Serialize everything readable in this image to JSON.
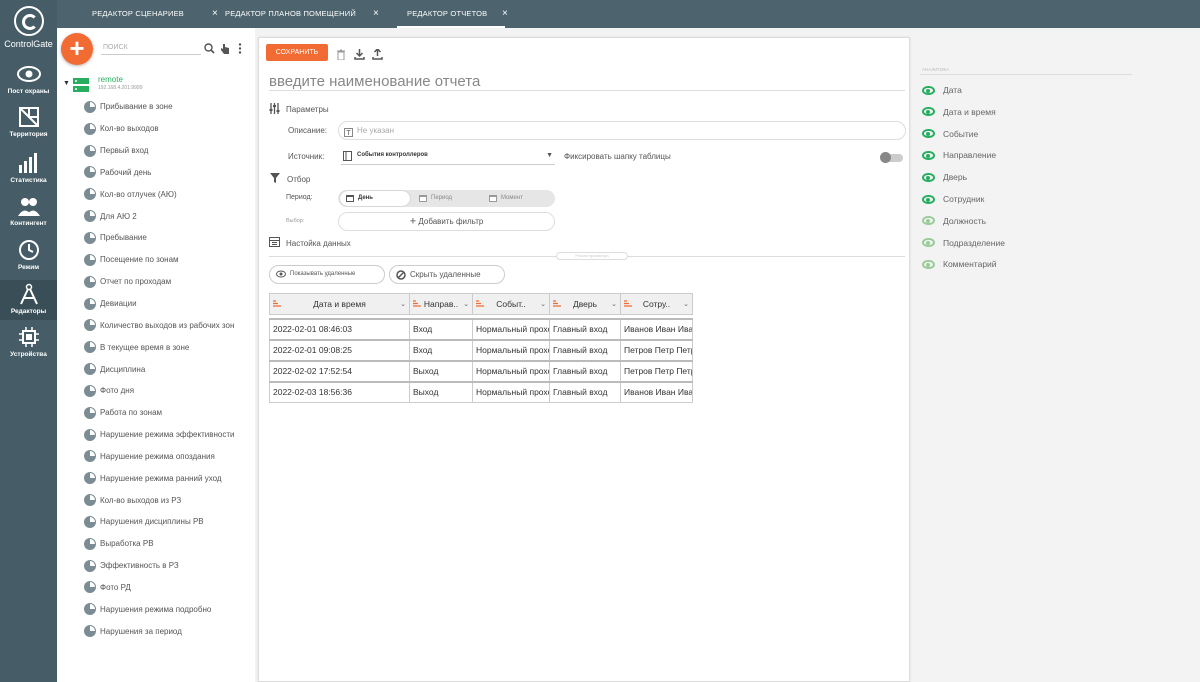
{
  "app": {
    "logo_text": "ControlGate"
  },
  "rail": [
    {
      "label": "Пост охраны",
      "icon": "eye-icon"
    },
    {
      "label": "Территория",
      "icon": "map-icon"
    },
    {
      "label": "Статистика",
      "icon": "bar-chart-icon"
    },
    {
      "label": "Контингент",
      "icon": "people-icon"
    },
    {
      "label": "Режим",
      "icon": "clock-icon"
    },
    {
      "label": "Редакторы",
      "icon": "compass-icon"
    },
    {
      "label": "Устройства",
      "icon": "chip-icon"
    }
  ],
  "tabs": [
    {
      "label": "РЕДАКТОР СЦЕНАРИЕВ",
      "close": "×"
    },
    {
      "label": "РЕДАКТОР ПЛАНОВ ПОМЕЩЕНИЙ",
      "close": "×"
    },
    {
      "label": "РЕДАКТОР ОТЧЕТОВ",
      "close": "×"
    }
  ],
  "sidebar": {
    "add_label": "+",
    "search_placeholder": "ПОИСК",
    "root": {
      "name": "remote",
      "ip": "192.168.4.201:9999"
    },
    "items": [
      "Прибывание в зоне",
      "Кол-во выходов",
      "Первый вход",
      "Рабочий день",
      "Кол-во отлучек (АЮ)",
      "Для АЮ 2",
      "Пребывание",
      "Посещение по зонам",
      "Отчет по проходам",
      "Девиации",
      "Количество выходов из рабочих зон",
      "В текущее время в зоне",
      "Дисциплина",
      "Фото дня",
      "Работа по зонам",
      "Нарушение режима эффективности",
      "Нарушение режима опоздания",
      "Нарушение режима ранний уход",
      "Кол-во выходов из РЗ",
      "Нарушения дисциплины РВ",
      "Выработка РВ",
      "Эффективность в РЗ",
      "Фото РД",
      "Нарушения режима подробно",
      "Нарушения за период"
    ]
  },
  "editor": {
    "save_label": "СОХРАНИТЬ",
    "title_placeholder": "введите наименование отчета",
    "params_label": "Параметры",
    "desc_label": "Описание:",
    "desc_placeholder": "Не указан",
    "source_label": "Источник:",
    "source_value": "События контроллеров",
    "fix_header_label": "Фиксировать шапку таблицы",
    "filter_label": "Отбор",
    "period_label": "Период:",
    "period_options": [
      "День",
      "Период",
      "Момент"
    ],
    "selection_label": "Выбор:",
    "add_filter_label": "Добавить фильтр",
    "data_settings_label": "Настойка данных",
    "divider_label": "Режим просмотра",
    "show_deleted_label": "Показывать удаленные",
    "hide_deleted_label": "Скрыть удаленные"
  },
  "table": {
    "columns": [
      "Дата и время",
      "Направ..",
      "Событ..",
      "Дверь",
      "Сотру.."
    ],
    "rows": [
      [
        "2022-02-01 08:46:03",
        "Вход",
        "Нормальный проход",
        "Главный вход",
        "Иванов Иван Иванович"
      ],
      [
        "2022-02-01 09:08:25",
        "Вход",
        "Нормальный проход",
        "Главный вход",
        "Петров Петр Петрович"
      ],
      [
        "2022-02-02 17:52:54",
        "Выход",
        "Нормальный проход",
        "Главный вход",
        "Петров Петр Петрович"
      ],
      [
        "2022-02-03 18:56:36",
        "Выход",
        "Нормальный проход",
        "Главный вход",
        "Иванов Иван Иванович"
      ]
    ]
  },
  "columns_panel": {
    "header": "АНАЛИТИКА",
    "items": [
      {
        "label": "Дата",
        "visible": true
      },
      {
        "label": "Дата и время",
        "visible": true
      },
      {
        "label": "Событие",
        "visible": true
      },
      {
        "label": "Направление",
        "visible": true
      },
      {
        "label": "Дверь",
        "visible": true
      },
      {
        "label": "Сотрудник",
        "visible": true
      },
      {
        "label": "Должность",
        "visible": false
      },
      {
        "label": "Подразделение",
        "visible": false
      },
      {
        "label": "Комментарий",
        "visible": false
      }
    ]
  },
  "colors": {
    "accent": "#f26b32",
    "rail": "#465c66",
    "tabbar": "#4d636d",
    "green": "#27ae60"
  }
}
